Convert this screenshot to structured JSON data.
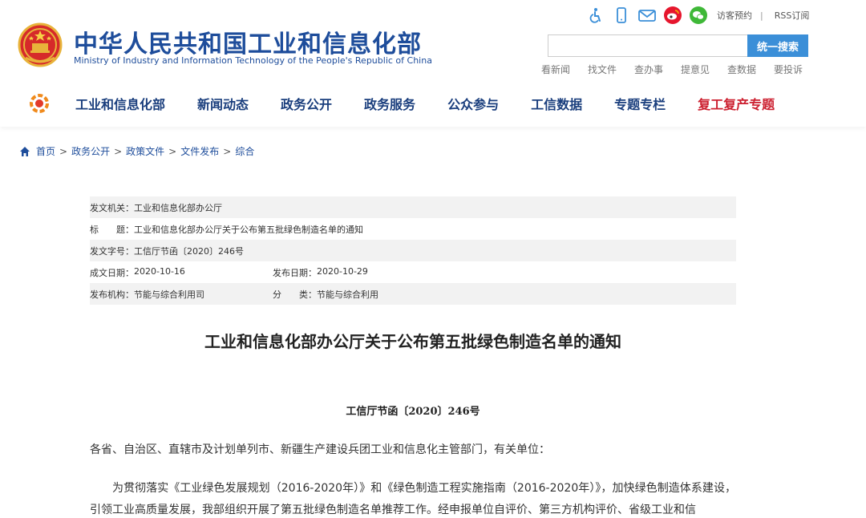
{
  "header": {
    "site_name": "中华人民共和国工业和信息化部",
    "site_sub": "Ministry of Industry and Information Technology of the People's Republic of China",
    "tools": {
      "visit": "访客预约",
      "sep": "|",
      "rss": "RSS订阅"
    },
    "search": {
      "placeholder": "",
      "button": "统一搜索"
    },
    "quick_links": [
      "看新闻",
      "找文件",
      "查办事",
      "提意见",
      "查数据",
      "要投诉"
    ],
    "nav": [
      "工业和信息化部",
      "新闻动态",
      "政务公开",
      "政务服务",
      "公众参与",
      "工信数据",
      "专题专栏",
      "复工复产专题"
    ]
  },
  "breadcrumb": [
    "首页",
    "政务公开",
    "政策文件",
    "文件发布",
    "综合"
  ],
  "meta": {
    "issuer_label": "发文机关：",
    "issuer": "工业和信息化部办公厅",
    "title_label": "标　　题：",
    "title": "工业和信息化部办公厅关于公布第五批绿色制造名单的通知",
    "docno_label": "发文字号：",
    "docno": "工信厅节函〔2020〕246号",
    "created_label": "成文日期：",
    "created": "2020-10-16",
    "published_label": "发布日期：",
    "published": "2020-10-29",
    "org_label": "发布机构：",
    "org": "节能与综合利用司",
    "category_label": "分　　类：",
    "category": "节能与综合利用"
  },
  "article": {
    "title": "工业和信息化部办公厅关于公布第五批绿色制造名单的通知",
    "docnum": "工信厅节函〔2020〕246号",
    "salutation": "各省、自治区、直辖市及计划单列市、新疆生产建设兵团工业和信息化主管部门，有关单位：",
    "paragraph": "为贯彻落实《工业绿色发展规划（2016-2020年）》和《绿色制造工程实施指南（2016-2020年）》，加快绿色制造体系建设，引领工业高质量发展，我部组织开展了第五批绿色制造名单推荐工作。经申报单位自评价、第三方机构评价、省级工业和信"
  },
  "colors": {
    "brand_blue": "#1e4d9b",
    "nav_blue": "#1a3e7d",
    "accent_red": "#cc1f2f",
    "search_btn": "#3b8fd8"
  },
  "icons": [
    "national-emblem-icon",
    "accessibility-icon",
    "mobile-icon",
    "mail-icon",
    "weibo-icon",
    "wechat-icon",
    "nav-logo-icon",
    "home-icon"
  ]
}
